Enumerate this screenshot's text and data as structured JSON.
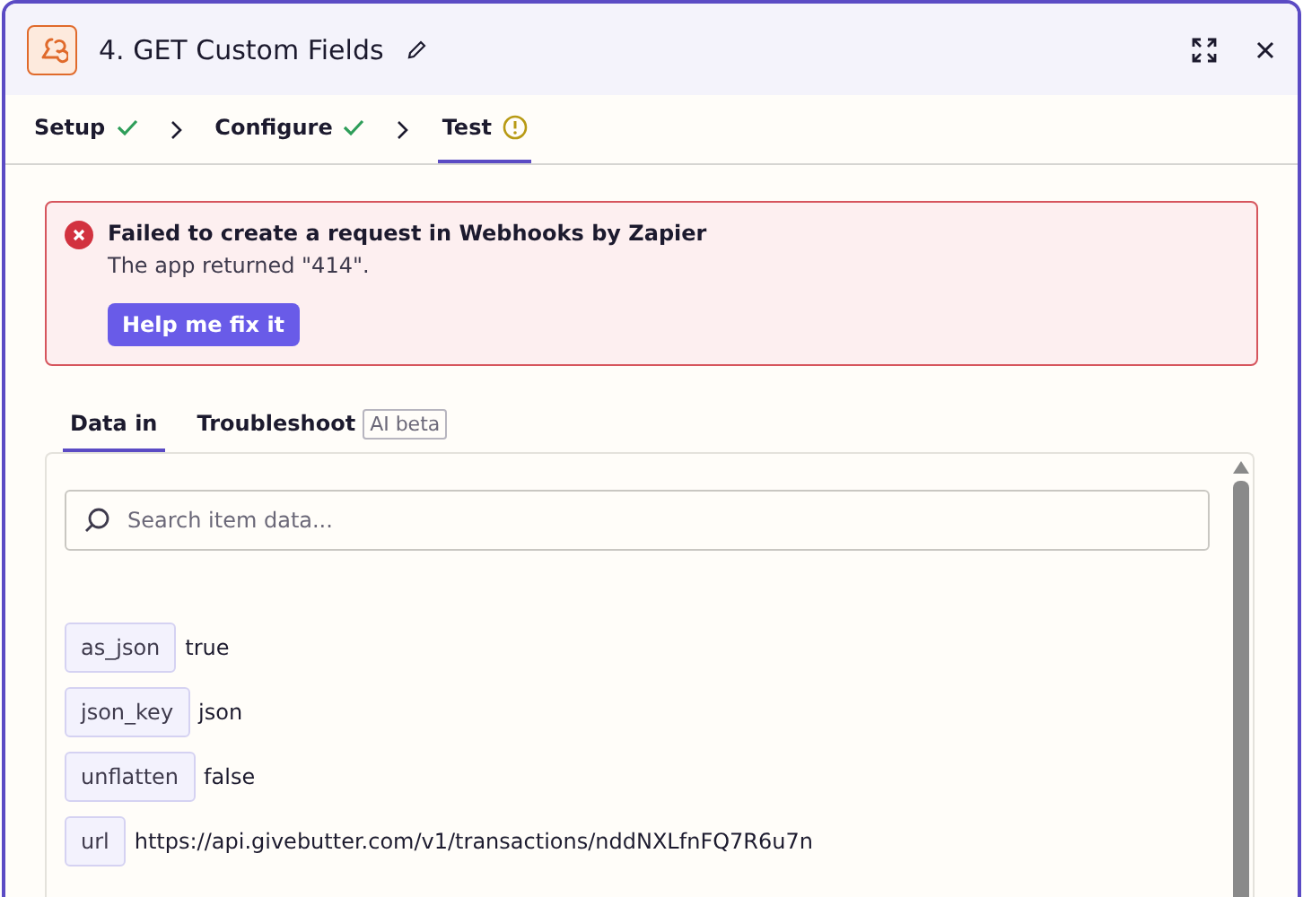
{
  "window": {
    "title": "4. GET Custom Fields"
  },
  "steps": [
    {
      "label": "Setup",
      "kind": "done",
      "selected": false
    },
    {
      "label": "Configure",
      "kind": "done",
      "selected": false
    },
    {
      "label": "Test",
      "kind": "warning",
      "selected": true
    }
  ],
  "alert": {
    "title": "Failed to create a request in Webhooks by Zapier",
    "message": "The app returned \"414\".",
    "button": "Help me fix it"
  },
  "tabs": [
    {
      "label": "Data in",
      "selected": true
    },
    {
      "label": "Troubleshoot",
      "badge": "AI beta",
      "selected": false
    }
  ],
  "search": {
    "placeholder": "Search item data..."
  },
  "fields": [
    {
      "key": "as_json",
      "value": "true"
    },
    {
      "key": "json_key",
      "value": "json"
    },
    {
      "key": "unflatten",
      "value": "false"
    },
    {
      "key": "url",
      "value": "https://api.givebutter.com/v1/transactions/nddNXLfnFQ7R6u7n"
    }
  ]
}
